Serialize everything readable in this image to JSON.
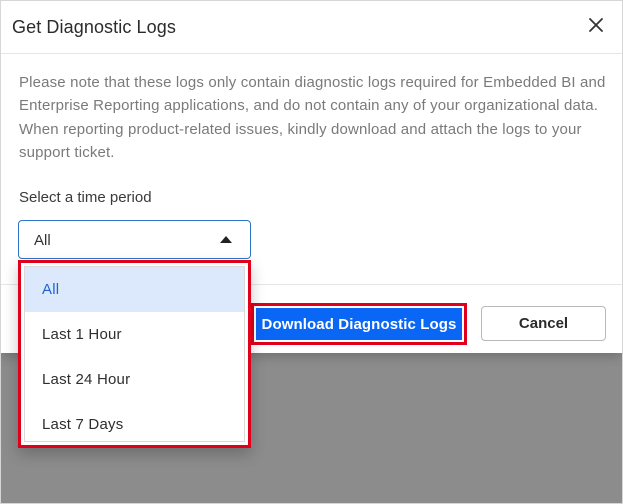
{
  "dialog": {
    "title": "Get Diagnostic Logs",
    "close_icon": "close-icon",
    "notice": "Please note that these logs only contain diagnostic logs required for Embedded BI and Enterprise Reporting applications, and do not contain any of your organizational data. When reporting product-related issues, kindly download and attach the logs to your support ticket.",
    "time_period": {
      "label": "Select a time period",
      "selected_value": "All",
      "caret_icon": "caret-up-icon",
      "options": [
        "All",
        "Last 1 Hour",
        "Last 24 Hour",
        "Last 7 Days"
      ],
      "selected_index": 0
    },
    "buttons": {
      "download_label": "Download Diagnostic Logs",
      "cancel_label": "Cancel"
    }
  },
  "colors": {
    "primary_button": "#0a67f5",
    "highlight_border": "#e0001b",
    "selected_option_bg": "#dce8fb",
    "selected_option_text": "#1e64d4",
    "select_border": "#2d74c9"
  }
}
